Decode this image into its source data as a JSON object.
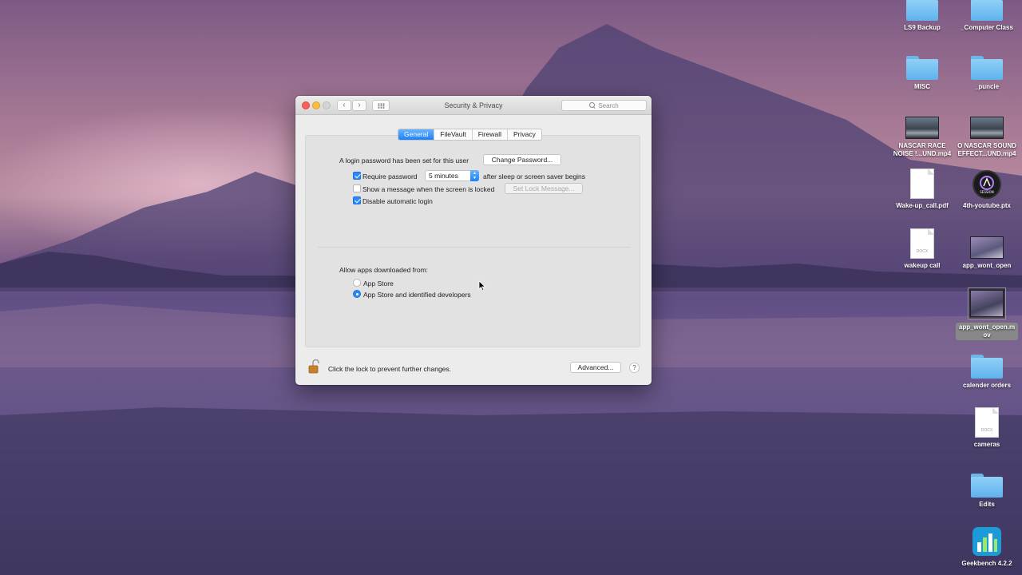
{
  "window": {
    "title": "Security & Privacy",
    "search_placeholder": "Search",
    "tabs": [
      {
        "label": "General",
        "active": true
      },
      {
        "label": "FileVault",
        "active": false
      },
      {
        "label": "Firewall",
        "active": false
      },
      {
        "label": "Privacy",
        "active": false
      }
    ],
    "general": {
      "login_text": "A login password has been set for this user",
      "change_password_label": "Change Password...",
      "require_password": {
        "label": "Require password",
        "checked": true
      },
      "require_delay": "5 minutes",
      "after_sleep_text": "after sleep or screen saver begins",
      "show_message": {
        "label": "Show a message when the screen is locked",
        "checked": false
      },
      "set_lock_message_label": "Set Lock Message...",
      "disable_auto_login": {
        "label": "Disable automatic login",
        "checked": true
      },
      "allow_apps_label": "Allow apps downloaded from:",
      "allow_options": [
        {
          "label": "App Store",
          "selected": false
        },
        {
          "label": "App Store and identified developers",
          "selected": true
        }
      ]
    },
    "footer": {
      "lock_text": "Click the lock to prevent further changes.",
      "advanced_label": "Advanced...",
      "help_label": "?"
    },
    "accent_color": "#1a82fb"
  },
  "desktop": {
    "items": [
      {
        "label": "LS9 Backup",
        "icon": "folder-icon"
      },
      {
        "label": "_Computer Class",
        "icon": "folder-icon"
      },
      {
        "label": "MISC",
        "icon": "folder-icon"
      },
      {
        "label": "_puncie",
        "icon": "folder-icon"
      },
      {
        "label": "NASCAR RACE NOISE !...UND.mp4",
        "icon": "video-thumbnail-icon"
      },
      {
        "label": "O NASCAR SOUND EFFECT...UND.mp4",
        "icon": "video-thumbnail-icon"
      },
      {
        "label": "Wake-up_call.pdf",
        "icon": "pdf-document-icon"
      },
      {
        "label": "4th-youtube.ptx",
        "icon": "pro-tools-session-icon"
      },
      {
        "label": "wakeup call",
        "icon": "docx-document-icon"
      },
      {
        "label": "app_wont_open",
        "icon": "image-thumbnail-icon"
      },
      {
        "label": "app_wont_open.mov",
        "icon": "video-thumbnail-icon"
      },
      {
        "label": "calender orders",
        "icon": "folder-icon"
      },
      {
        "label": "cameras",
        "icon": "docx-document-icon"
      },
      {
        "label": "Edits",
        "icon": "folder-icon"
      },
      {
        "label": "Geekbench 4.2.2",
        "icon": "geekbench-app-icon"
      }
    ],
    "doc_badge": "DOCX",
    "session_badge": "SESSION"
  }
}
